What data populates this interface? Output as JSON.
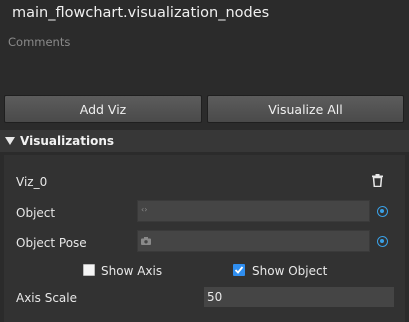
{
  "header": {
    "title": "main_flowchart.visualization_nodes",
    "comments": "Comments"
  },
  "buttons": {
    "add_viz": "Add Viz",
    "visualize_all": "Visualize All"
  },
  "section": {
    "title": "Visualizations"
  },
  "viz": {
    "name": "Viz_0",
    "object_label": "Object",
    "object_value": "",
    "object_pose_label": "Object Pose",
    "object_pose_value": "",
    "show_axis_label": "Show Axis",
    "show_axis_checked": false,
    "show_object_label": "Show Object",
    "show_object_checked": true,
    "axis_scale_label": "Axis Scale",
    "axis_scale_value": "50"
  },
  "colors": {
    "accent": "#3aa0e6",
    "checkbox_on": "#2f8ef0",
    "background": "#2b2b2b"
  },
  "icons": [
    "trash-icon",
    "target-icon",
    "object-link-icon",
    "camera-icon",
    "collapse-triangle-icon",
    "checkmark-icon"
  ]
}
